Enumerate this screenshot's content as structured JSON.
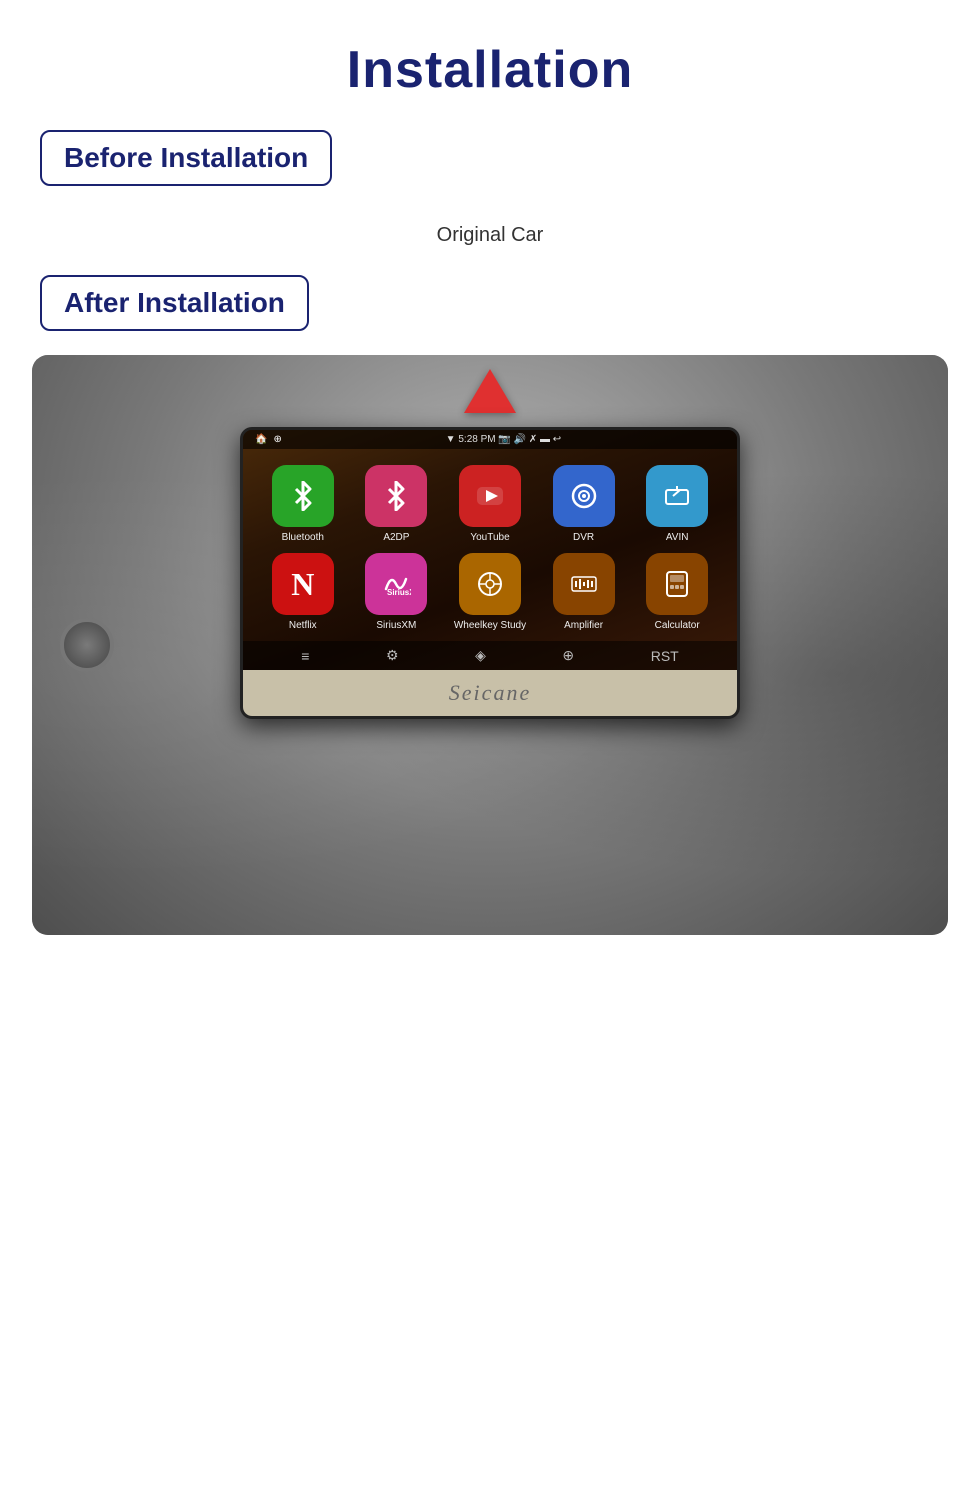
{
  "page": {
    "title": "Installation"
  },
  "before_section": {
    "badge": "Before Installation",
    "caption": "Original Car"
  },
  "after_section": {
    "badge": "After Installation"
  },
  "apps": [
    {
      "id": "bluetooth",
      "label": "Bluetooth",
      "icon": "🔵",
      "color_class": "app-bluetooth",
      "symbol": "⚡",
      "row": 1
    },
    {
      "id": "a2dp",
      "label": "A2DP",
      "icon": "✱",
      "color_class": "app-a2dp",
      "row": 1
    },
    {
      "id": "youtube",
      "label": "YouTube",
      "icon": "▶",
      "color_class": "app-youtube",
      "row": 1
    },
    {
      "id": "dvr",
      "label": "DVR",
      "icon": "◎",
      "color_class": "app-dvr",
      "row": 1
    },
    {
      "id": "avin",
      "label": "AVIN",
      "icon": "⇥",
      "color_class": "app-avin",
      "row": 1
    },
    {
      "id": "netflix",
      "label": "Netflix",
      "icon": "N",
      "color_class": "app-netflix",
      "row": 2
    },
    {
      "id": "siriusxm",
      "label": "SiriusXM",
      "icon": "〜",
      "color_class": "app-siriusxm",
      "row": 2
    },
    {
      "id": "wheelkey",
      "label": "Wheelkey Study",
      "icon": "⊕",
      "color_class": "app-wheelkey",
      "row": 2
    },
    {
      "id": "amplifier",
      "label": "Amplifier",
      "icon": "▦",
      "color_class": "app-amplifier",
      "row": 2
    },
    {
      "id": "calculator",
      "label": "Calculator",
      "icon": "⊞",
      "color_class": "app-calculator",
      "row": 2
    }
  ],
  "status_bar": {
    "time": "5:28 PM",
    "signal": "▼"
  },
  "brand": "Seicane"
}
